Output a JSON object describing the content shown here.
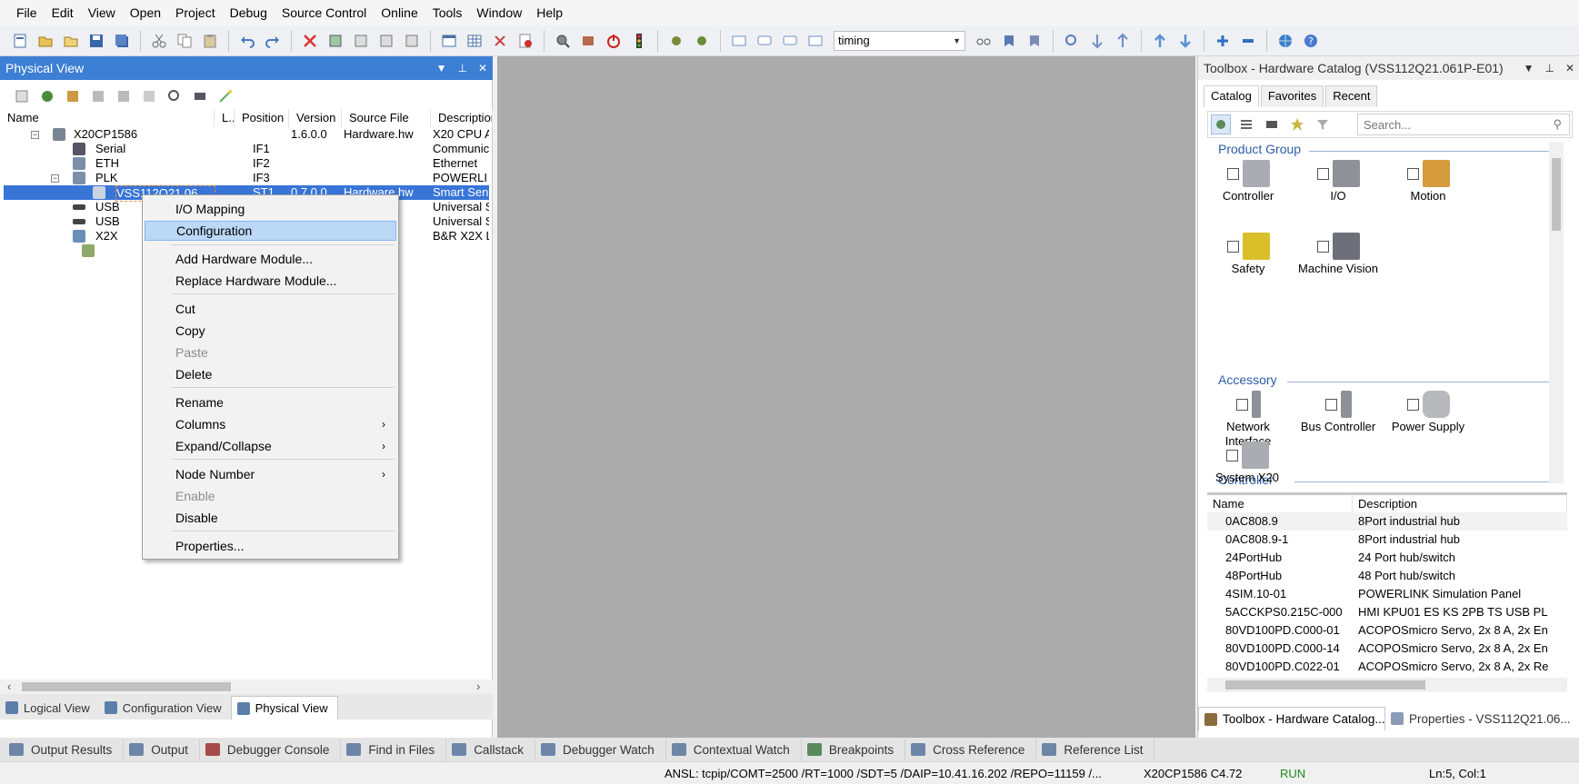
{
  "menu": [
    "File",
    "Edit",
    "View",
    "Open",
    "Project",
    "Debug",
    "Source Control",
    "Online",
    "Tools",
    "Window",
    "Help"
  ],
  "toolbar": {
    "config_combo": "timing"
  },
  "physical_view": {
    "title": "Physical View",
    "columns": [
      "Name",
      "L...",
      "Position",
      "Version",
      "Source File",
      "Description"
    ],
    "rows": [
      {
        "name": "X20CP1586",
        "position": "",
        "version": "1.6.0.0",
        "source": "Hardware.hw",
        "desc": "X20 CPU A"
      },
      {
        "name": "Serial",
        "position": "IF1",
        "version": "",
        "source": "",
        "desc": "Communic"
      },
      {
        "name": "ETH",
        "position": "IF2",
        "version": "",
        "source": "",
        "desc": "Ethernet"
      },
      {
        "name": "PLK",
        "position": "IF3",
        "version": "",
        "source": "",
        "desc": "POWERLI"
      },
      {
        "name": "VSS112Q21.06",
        "position": "ST1",
        "version": "0.7.0.0",
        "source": "Hardware.hw",
        "desc": "Smart Sen"
      },
      {
        "name": "USB",
        "position": "",
        "version": "",
        "source": "",
        "desc": "Universal S"
      },
      {
        "name": "USB",
        "position": "",
        "version": "",
        "source": "",
        "desc": "Universal S"
      },
      {
        "name": "X2X",
        "position": "",
        "version": "",
        "source": "",
        "desc": "B&R X2X L"
      }
    ],
    "bottom_tabs": [
      "Logical View",
      "Configuration View",
      "Physical View"
    ]
  },
  "context_menu": {
    "items": [
      {
        "label": "I/O Mapping"
      },
      {
        "label": "Configuration"
      },
      {
        "label": "Add Hardware Module..."
      },
      {
        "label": "Replace Hardware Module..."
      },
      {
        "label": "Cut"
      },
      {
        "label": "Copy"
      },
      {
        "label": "Paste"
      },
      {
        "label": "Delete"
      },
      {
        "label": "Rename"
      },
      {
        "label": "Columns"
      },
      {
        "label": "Expand/Collapse"
      },
      {
        "label": "Node Number"
      },
      {
        "label": "Enable"
      },
      {
        "label": "Disable"
      },
      {
        "label": "Properties..."
      }
    ],
    "submenu_glyph": "›"
  },
  "toolbox": {
    "title": "Toolbox - Hardware Catalog (VSS112Q21.061P-E01)",
    "tabs": [
      "Catalog",
      "Favorites",
      "Recent"
    ],
    "search_placeholder": "Search...",
    "sections": {
      "product_group": "Product Group",
      "accessory": "Accessory",
      "controller": "Controller"
    },
    "product_items": [
      "Controller",
      "I/O",
      "Motion",
      "Safety",
      "Machine Vision"
    ],
    "accessory_items": [
      "Network Interface",
      "Bus Controller",
      "Power Supply"
    ],
    "controller_items": [
      "System X20"
    ],
    "list_columns": [
      "Name",
      "Description"
    ],
    "list_rows": [
      {
        "name": "0AC808.9",
        "desc": "8Port industrial hub"
      },
      {
        "name": "0AC808.9-1",
        "desc": "8Port industrial hub"
      },
      {
        "name": "24PortHub",
        "desc": "24 Port hub/switch"
      },
      {
        "name": "48PortHub",
        "desc": "48 Port hub/switch"
      },
      {
        "name": "4SIM.10-01",
        "desc": "POWERLINK Simulation Panel"
      },
      {
        "name": "5ACCKPS0.215C-000",
        "desc": "HMI KPU01 ES KS 2PB TS USB PL"
      },
      {
        "name": "80VD100PD.C000-01",
        "desc": "ACOPOSmicro Servo, 2x 8 A, 2x En"
      },
      {
        "name": "80VD100PD.C000-14",
        "desc": "ACOPOSmicro Servo, 2x 8 A, 2x En"
      },
      {
        "name": "80VD100PD.C022-01",
        "desc": "ACOPOSmicro Servo, 2x 8 A, 2x Re"
      }
    ],
    "bottom_tabs": [
      "Toolbox - Hardware Catalog...",
      "Properties - VSS112Q21.06..."
    ]
  },
  "output_tabs": [
    "Output Results",
    "Output",
    "Debugger Console",
    "Find in Files",
    "Callstack",
    "Debugger Watch",
    "Contextual Watch",
    "Breakpoints",
    "Cross Reference",
    "Reference List"
  ],
  "status": {
    "connection": "ANSL: tcpip/COMT=2500 /RT=1000 /SDT=5 /DAIP=10.41.16.202 /REPO=11159 /...",
    "target": "X20CP1586  C4.72",
    "mode": "RUN",
    "position": "Ln:5, Col:1"
  },
  "colors": {
    "accent": "#3c7fd4",
    "selection": "#3875d7",
    "menu_highlight": "#bcd8f7",
    "editor_bg": "#ababab",
    "run_green": "#1a8a1a"
  }
}
